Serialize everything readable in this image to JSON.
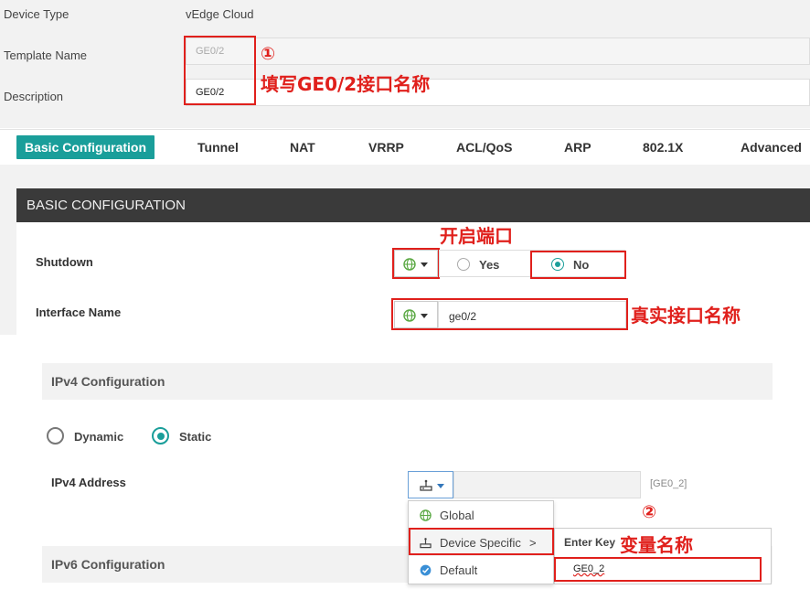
{
  "top": {
    "device_type_label": "Device Type",
    "device_type_value": "vEdge Cloud",
    "template_name_label": "Template Name",
    "template_name_value": "GE0/2",
    "description_label": "Description",
    "description_value": "GE0/2"
  },
  "annotations": {
    "marker1": "①",
    "note1": "填写GE0/2接口名称",
    "note_open_port": "开启端口",
    "note_real_name": "真实接口名称",
    "marker2": "②",
    "note_variable": "变量名称",
    "color": "#e0201c"
  },
  "tabs": [
    {
      "label": "Basic Configuration",
      "active": true
    },
    {
      "label": "Tunnel"
    },
    {
      "label": "NAT"
    },
    {
      "label": "VRRP"
    },
    {
      "label": "ACL/QoS"
    },
    {
      "label": "ARP"
    },
    {
      "label": "802.1X"
    },
    {
      "label": "Advanced"
    }
  ],
  "basic": {
    "header": "BASIC CONFIGURATION",
    "shutdown_label": "Shutdown",
    "yes_label": "Yes",
    "no_label": "No",
    "shutdown_selected": "No",
    "interface_name_label": "Interface Name",
    "interface_name_value": "ge0/2"
  },
  "ipv4": {
    "header": "IPv4 Configuration",
    "dynamic_label": "Dynamic",
    "static_label": "Static",
    "selected": "Static",
    "address_label": "IPv4 Address",
    "address_variable": "[GE0_2]",
    "menu": [
      {
        "label": "Global",
        "icon": "globe-icon"
      },
      {
        "label": "Device Specific",
        "icon": "device-icon",
        "arrow": ">"
      },
      {
        "label": "Default",
        "icon": "check-icon"
      }
    ],
    "enter_key_label": "Enter Key",
    "key_value": "GE0_2"
  },
  "ipv6": {
    "header": "IPv6 Configuration"
  },
  "colors": {
    "accent": "#1a9e9a",
    "dark_header": "#3a3a3a",
    "panel_bg": "#f2f2f2"
  }
}
